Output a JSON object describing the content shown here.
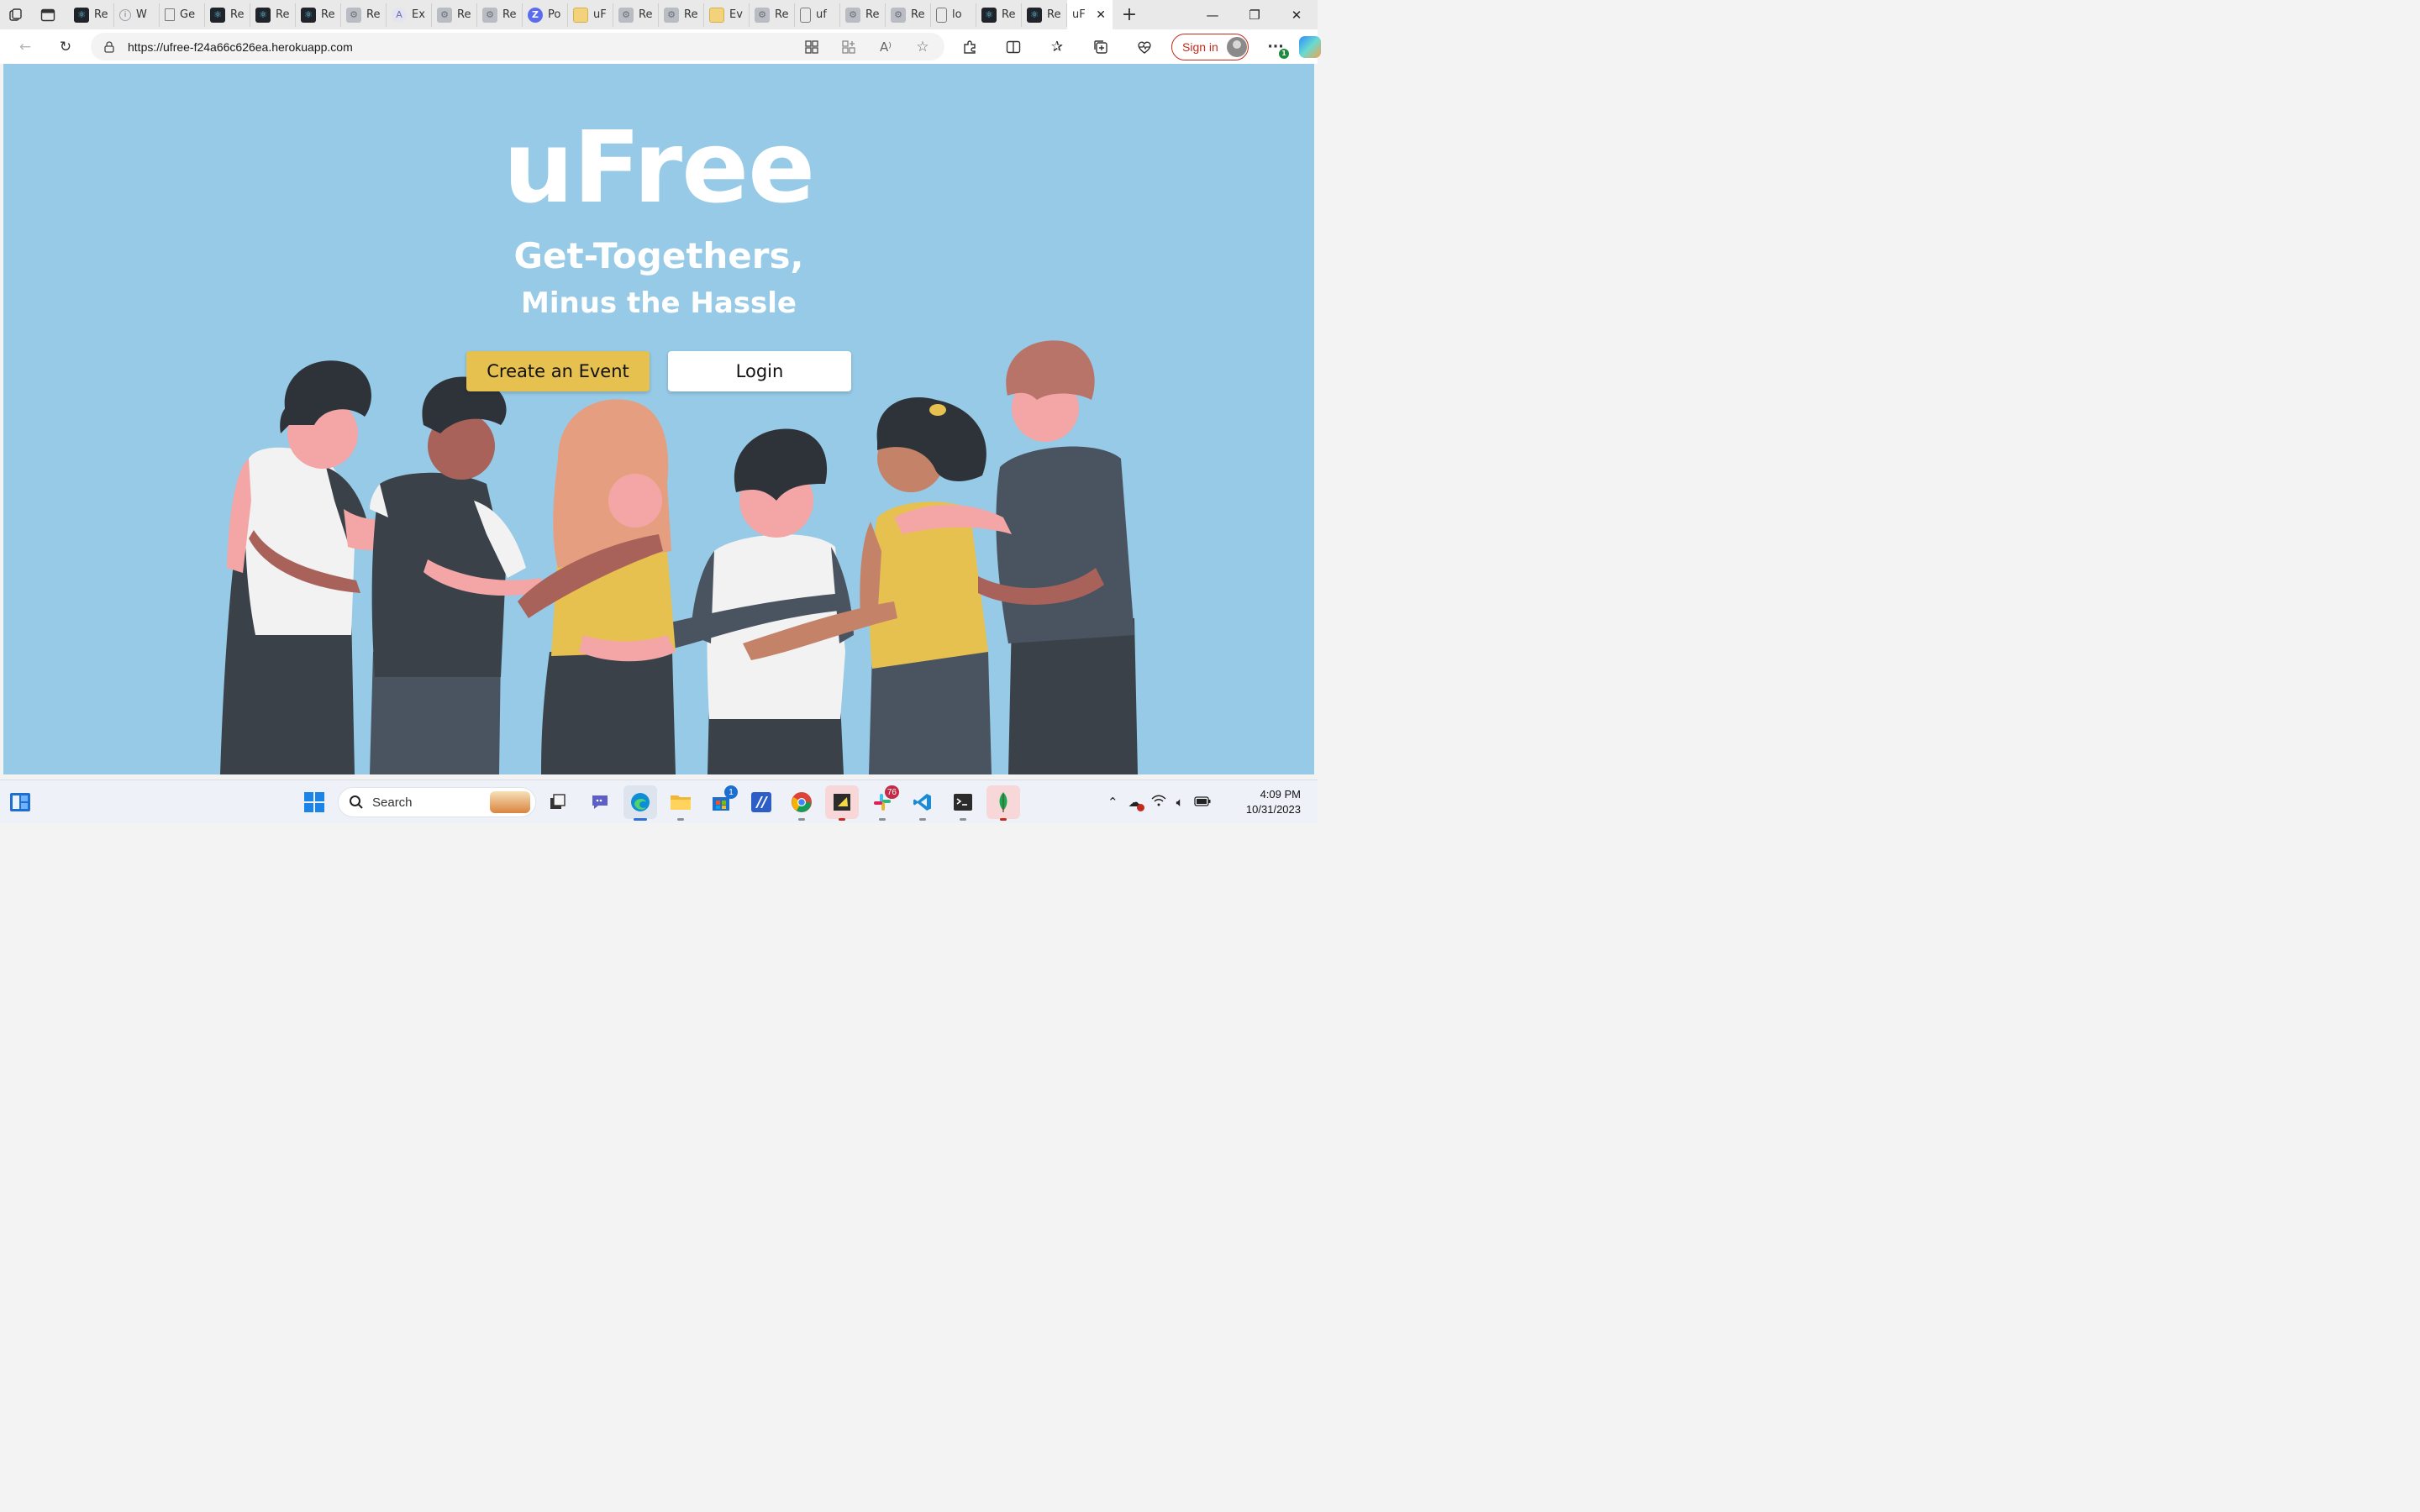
{
  "browser": {
    "tabs": [
      {
        "icon": "react-icon",
        "label": "Re"
      },
      {
        "icon": "info-icon",
        "label": "W"
      },
      {
        "icon": "document-icon",
        "label": "Ge"
      },
      {
        "icon": "react-icon",
        "label": "Re"
      },
      {
        "icon": "react-icon",
        "label": "Re"
      },
      {
        "icon": "react-icon",
        "label": "Re"
      },
      {
        "icon": "gear-icon",
        "label": "Re"
      },
      {
        "icon": "explore-icon",
        "label": "Ex"
      },
      {
        "icon": "gear-icon",
        "label": "Re"
      },
      {
        "icon": "gear-icon",
        "label": "Re"
      },
      {
        "icon": "zoom-icon",
        "label": "Po"
      },
      {
        "icon": "folder-icon",
        "label": "uF"
      },
      {
        "icon": "gear-icon",
        "label": "Re"
      },
      {
        "icon": "gear-icon",
        "label": "Re"
      },
      {
        "icon": "folder-icon",
        "label": "Ev"
      },
      {
        "icon": "gear-icon",
        "label": "Re"
      },
      {
        "icon": "file-icon",
        "label": "uf"
      },
      {
        "icon": "gear-icon",
        "label": "Re"
      },
      {
        "icon": "gear-icon",
        "label": "Re"
      },
      {
        "icon": "file-icon",
        "label": "lo"
      },
      {
        "icon": "react-icon",
        "label": "Re"
      },
      {
        "icon": "react-icon",
        "label": "Re"
      }
    ],
    "active_tab": {
      "label": "uF",
      "close": "✕"
    },
    "new_tab": "+",
    "url": "https://ufree-f24a66c626ea.herokuapp.com",
    "sign_in": "Sign in",
    "extensions_badge": "1"
  },
  "page": {
    "title": "uFree",
    "subtitle_line1": "Get-Togethers,",
    "subtitle_line2": "Minus the Hassle",
    "create_button": "Create an Event",
    "login_button": "Login",
    "colors": {
      "background": "#96cae6",
      "create_button": "#e7c14f",
      "login_button": "#ffffff"
    }
  },
  "taskbar": {
    "search_placeholder": "Search",
    "store_badge": "1",
    "slack_badge": "76",
    "time": "4:09 PM",
    "date": "10/31/2023"
  }
}
